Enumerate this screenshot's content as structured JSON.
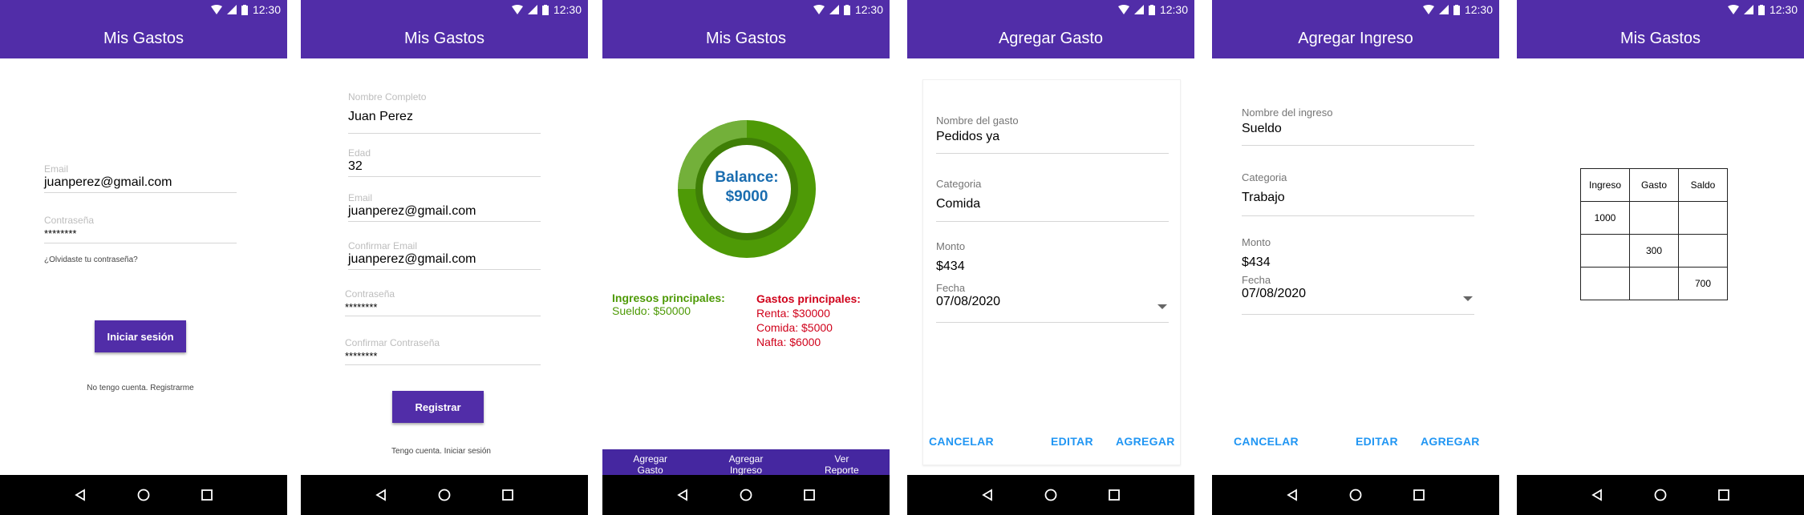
{
  "status": {
    "time": "12:30"
  },
  "colors": {
    "primary": "#512DA8",
    "accent": "#2196F3",
    "income": "#4E9A06",
    "expense": "#D0021B",
    "balance_text": "#1A6DB0"
  },
  "login": {
    "title": "Mis Gastos",
    "email_label": "Email",
    "email_value": "juanperez@gmail.com",
    "password_label": "Contraseña",
    "password_value": "********",
    "forgot": "¿Olvidaste tu contraseña?",
    "login_button": "Iniciar sesión",
    "register_link": "No tengo cuenta. Registrarme"
  },
  "register": {
    "title": "Mis Gastos",
    "name_label": "Nombre Completo",
    "name_value": "Juan Perez",
    "age_label": "Edad",
    "age_value": "32",
    "email_label": "Email",
    "email_value": "juanperez@gmail.com",
    "confirm_email_label": "Confirmar Email",
    "confirm_email_value": "juanperez@gmail.com",
    "password_label": "Contraseña",
    "password_value": "********",
    "confirm_password_label": "Confirmar Contraseña",
    "confirm_password_value": "********",
    "register_button": "Registrar",
    "login_link": "Tengo cuenta. Iniciar sesión"
  },
  "dashboard": {
    "title": "Mis Gastos",
    "balance_label": "Balance:",
    "balance_value": "$9000",
    "income_title": "Ingresos principales:",
    "income_items": [
      "Sueldo: $50000"
    ],
    "expense_title": "Gastos principales:",
    "expense_items": [
      "Renta: $30000",
      "Comida: $5000",
      "Nafta: $6000"
    ],
    "bottom_nav": [
      {
        "line1": "Agregar",
        "line2": "Gasto"
      },
      {
        "line1": "Agregar",
        "line2": "Ingreso"
      },
      {
        "line1": "Ver",
        "line2": "Reporte"
      }
    ]
  },
  "add_expense": {
    "title": "Agregar Gasto",
    "name_label": "Nombre del gasto",
    "name_value": "Pedidos ya",
    "category_label": "Categoria",
    "category_value": "Comida",
    "amount_label": "Monto",
    "amount_value": "$434",
    "date_label": "Fecha",
    "date_value": "07/08/2020",
    "cancel": "CANCELAR",
    "edit": "EDITAR",
    "add": "AGREGAR"
  },
  "add_income": {
    "title": "Agregar Ingreso",
    "name_label": "Nombre del ingreso",
    "name_value": "Sueldo",
    "category_label": "Categoria",
    "category_value": "Trabajo",
    "amount_label": "Monto",
    "amount_value": "$434",
    "date_label": "Fecha",
    "date_value": "07/08/2020",
    "cancel": "CANCELAR",
    "edit": "EDITAR",
    "add": "AGREGAR"
  },
  "report": {
    "title": "Mis Gastos",
    "headers": [
      "Ingreso",
      "Gasto",
      "Saldo"
    ],
    "rows": [
      [
        "1000",
        "",
        ""
      ],
      [
        "",
        "300",
        ""
      ],
      [
        "",
        "",
        "700"
      ]
    ]
  }
}
